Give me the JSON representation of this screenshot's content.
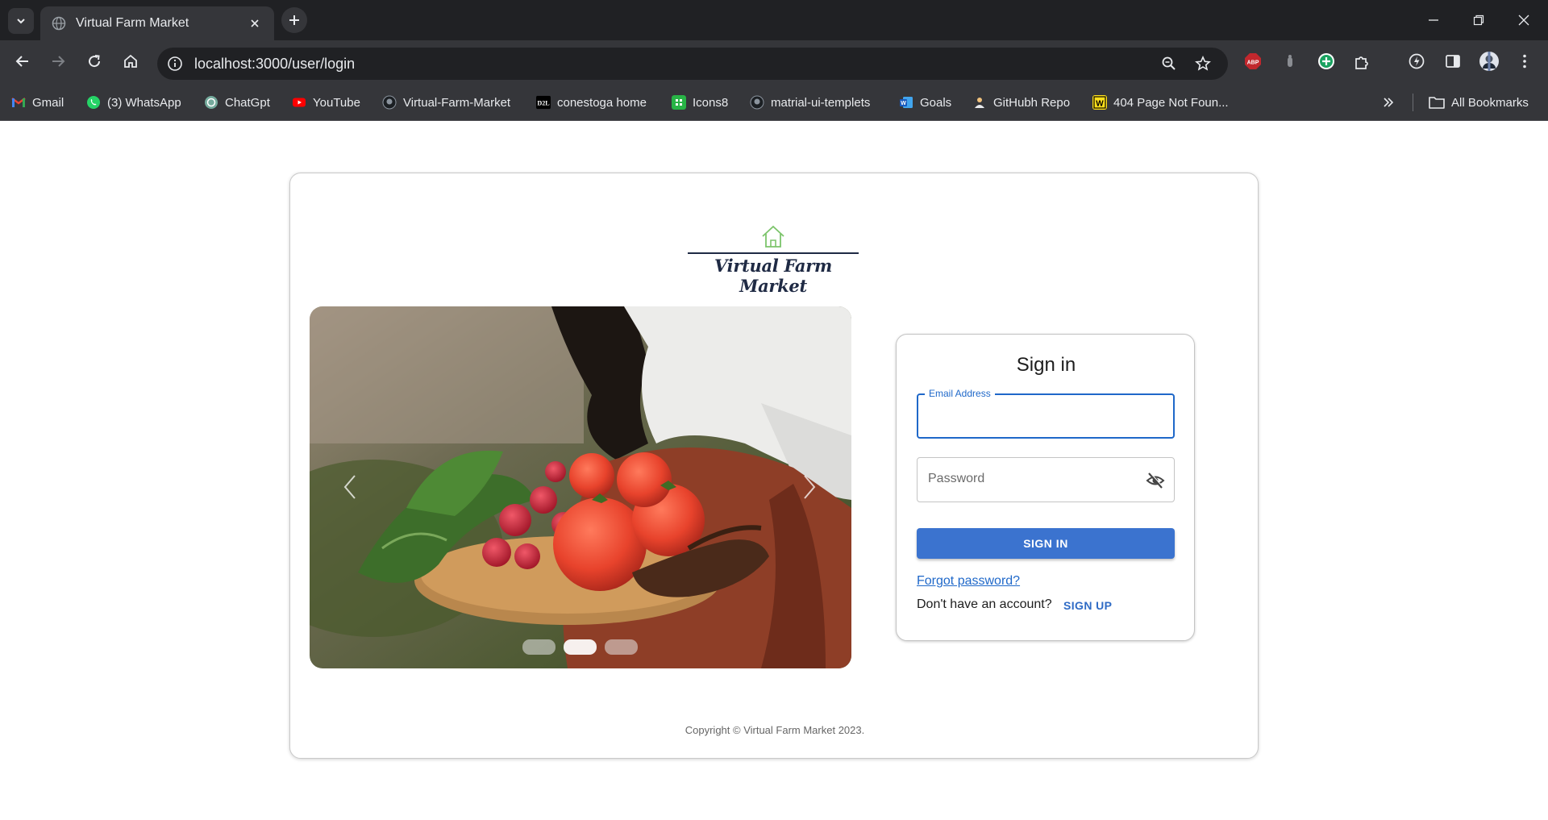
{
  "browser": {
    "tab_title": "Virtual Farm Market",
    "url": "localhost:3000/user/login",
    "bookmarks": [
      {
        "label": "Gmail",
        "icon": "gmail-icon"
      },
      {
        "label": "(3) WhatsApp",
        "icon": "whatsapp-icon"
      },
      {
        "label": "ChatGpt",
        "icon": "chatgpt-icon"
      },
      {
        "label": "YouTube",
        "icon": "youtube-icon"
      },
      {
        "label": "Virtual-Farm-Market",
        "icon": "github-icon"
      },
      {
        "label": "conestoga home",
        "icon": "d2l-icon"
      },
      {
        "label": "Icons8",
        "icon": "icons8-icon"
      },
      {
        "label": "matrial-ui-templets",
        "icon": "github-icon"
      },
      {
        "label": "Goals",
        "icon": "word-icon"
      },
      {
        "label": "GitHubh Repo",
        "icon": "person-icon"
      },
      {
        "label": "404 Page Not Foun...",
        "icon": "w-icon"
      }
    ],
    "all_bookmarks": "All Bookmarks",
    "d2l_text": "D2L",
    "abp_text": "ABP"
  },
  "page": {
    "brand": "Virtual Farm Market",
    "signin": {
      "title": "Sign in",
      "email_label": "Email Address",
      "email_value": "",
      "password_placeholder": "Password",
      "submit": "SIGN IN",
      "forgot": "Forgot password?",
      "no_account": "Don't have an account?",
      "signup": "SIGN UP"
    },
    "carousel": {
      "slide_count": 3,
      "active_index": 1
    },
    "copyright": "Copyright © Virtual Farm Market  2023."
  }
}
